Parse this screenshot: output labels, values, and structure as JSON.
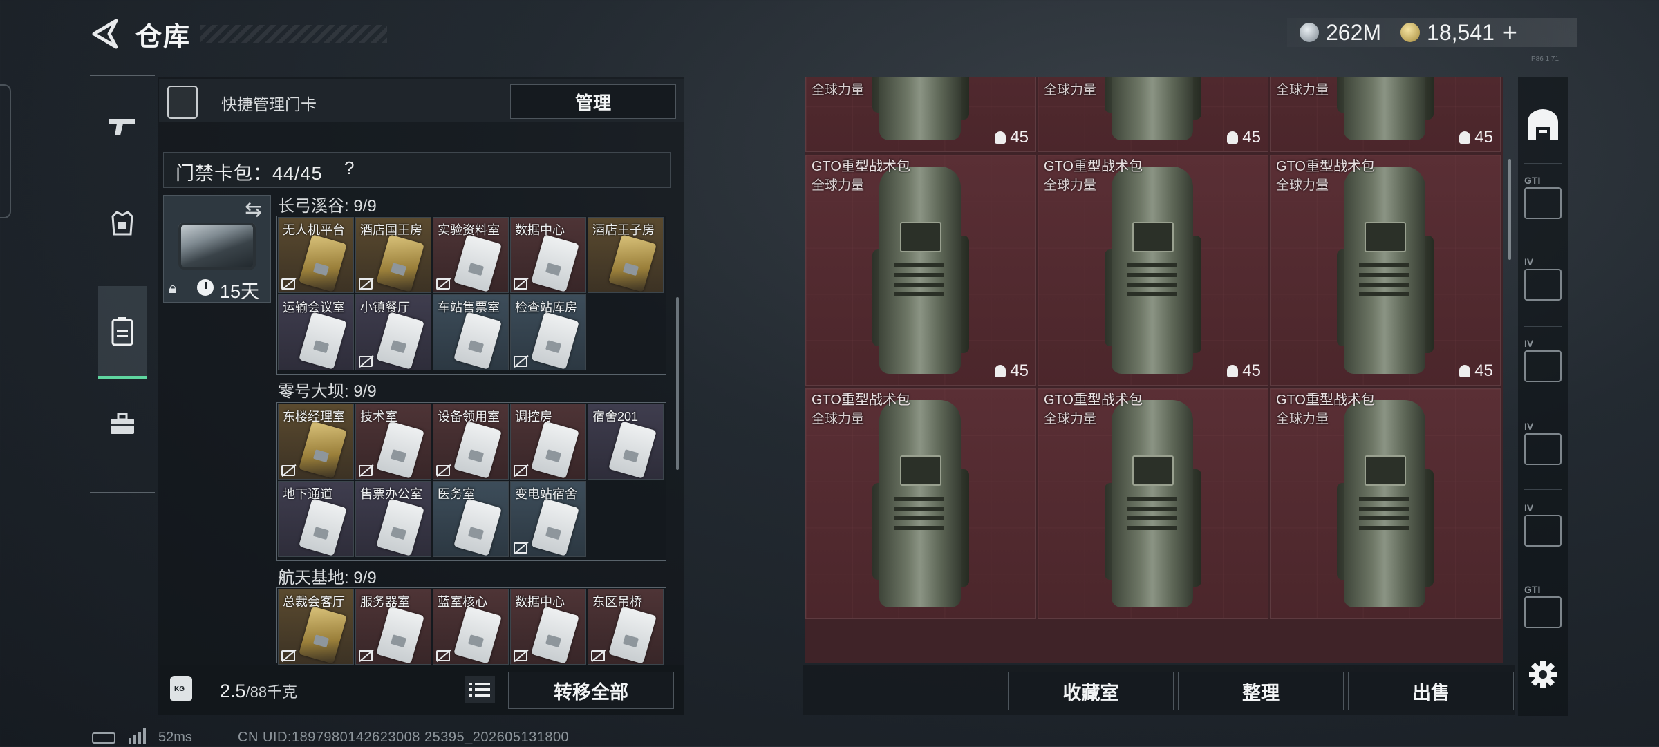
{
  "header": {
    "title": "仓库",
    "currency_silver": "262M",
    "currency_gold": "18,541",
    "add_symbol": "+",
    "version": "P86 1.71"
  },
  "keycard_panel": {
    "quick_manage_label": "快捷管理门卡",
    "manage_button": "管理",
    "capacity_label": "门禁卡包：44/45",
    "help_symbol": "?",
    "cardpack_timer": "15天",
    "groups": [
      {
        "title": "长弓溪谷: 9/9",
        "cards": [
          {
            "name": "无人机平台",
            "color": "gold",
            "untradeable": true
          },
          {
            "name": "酒店国王房",
            "color": "gold",
            "untradeable": true
          },
          {
            "name": "实验资料室",
            "color": "red",
            "untradeable": true
          },
          {
            "name": "数据中心",
            "color": "red",
            "untradeable": true
          },
          {
            "name": "酒店王子房",
            "color": "gold",
            "untradeable": false
          },
          {
            "name": "运输会议室",
            "color": "purple",
            "untradeable": false
          },
          {
            "name": "小镇餐厅",
            "color": "purple",
            "untradeable": true
          },
          {
            "name": "车站售票室",
            "color": "blue",
            "untradeable": false
          },
          {
            "name": "检查站库房",
            "color": "blue",
            "untradeable": true
          }
        ]
      },
      {
        "title": "零号大坝: 9/9",
        "cards": [
          {
            "name": "东楼经理室",
            "color": "gold",
            "untradeable": true
          },
          {
            "name": "技术室",
            "color": "red",
            "untradeable": true
          },
          {
            "name": "设备领用室",
            "color": "red",
            "untradeable": true
          },
          {
            "name": "调控房",
            "color": "red",
            "untradeable": true
          },
          {
            "name": "宿舍201",
            "color": "purple",
            "untradeable": false
          },
          {
            "name": "地下通道",
            "color": "purple",
            "untradeable": false
          },
          {
            "name": "售票办公室",
            "color": "purple",
            "untradeable": false
          },
          {
            "name": "医务室",
            "color": "blue",
            "untradeable": false
          },
          {
            "name": "变电站宿舍",
            "color": "blue",
            "untradeable": true
          }
        ]
      },
      {
        "title": "航天基地: 9/9",
        "cards": [
          {
            "name": "总裁会客厅",
            "color": "gold",
            "untradeable": true
          },
          {
            "name": "服务器室",
            "color": "red",
            "untradeable": true
          },
          {
            "name": "蓝室核心",
            "color": "red",
            "untradeable": true
          },
          {
            "name": "数据中心",
            "color": "red",
            "untradeable": true
          },
          {
            "name": "东区吊桥",
            "color": "red",
            "untradeable": true
          }
        ]
      }
    ],
    "weight": "2.5",
    "weight_max": "/88千克",
    "weight_icon_text": "KG",
    "transfer_all_button": "转移全部"
  },
  "storage": {
    "items": [
      {
        "name": "",
        "sub": "全球力量",
        "count": "45"
      },
      {
        "name": "",
        "sub": "全球力量",
        "count": "45"
      },
      {
        "name": "",
        "sub": "全球力量",
        "count": "45"
      },
      {
        "name": "GTO重型战术包",
        "sub": "全球力量",
        "count": "45"
      },
      {
        "name": "GTO重型战术包",
        "sub": "全球力量",
        "count": "45"
      },
      {
        "name": "GTO重型战术包",
        "sub": "全球力量",
        "count": "45"
      },
      {
        "name": "GTO重型战术包",
        "sub": "全球力量",
        "count": ""
      },
      {
        "name": "GTO重型战术包",
        "sub": "全球力量",
        "count": ""
      },
      {
        "name": "GTO重型战术包",
        "sub": "全球力量",
        "count": ""
      }
    ],
    "collection_button": "收藏室",
    "sort_button": "整理",
    "sell_button": "出售"
  },
  "right_rail": {
    "buttons": [
      "warehouse-icon",
      "gti-case-icon",
      "iv-folder-icon",
      "iv-folder-icon",
      "iv-case-add-icon",
      "iv-case-add-icon",
      "gti-case-icon",
      "settings-icon"
    ],
    "labels": [
      "GTI",
      "IV",
      "IV",
      "IV",
      "IV",
      "GTI"
    ]
  },
  "status": {
    "ping": "52ms",
    "uid": "CN UID:1897980142623008 25395_202605131800"
  }
}
